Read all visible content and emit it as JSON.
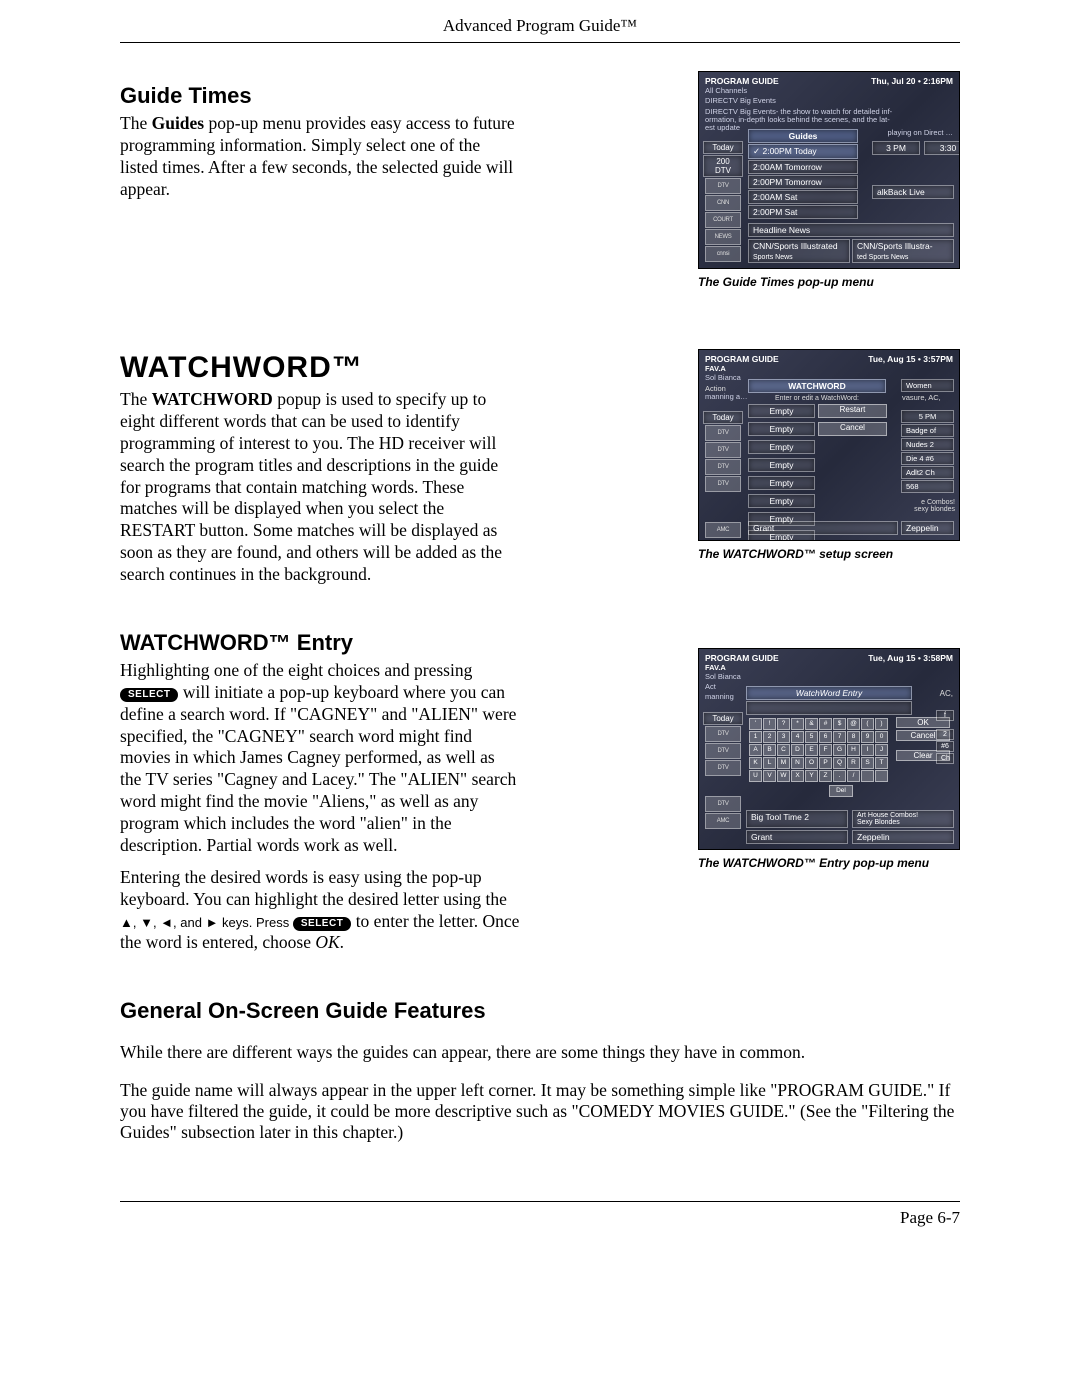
{
  "running_head": "Advanced Program Guide™",
  "footer": "Page 6-7",
  "guide_times": {
    "heading": "Guide Times",
    "body_html": "The <b>Guides</b> pop-up menu provides easy access to future programming information. Simply select one of the listed times. After a few seconds, the selected guide will appear.",
    "caption": "The Guide Times pop-up menu",
    "shot": {
      "title": "PROGRAM GUIDE",
      "subtitle": "All Channels",
      "datetime": "Thu, Jul 20 • 2:16PM",
      "banner_line2": "DIRECTV  Big Events",
      "banner_line3": "DIRECTV Big Events- the show to watch for detailed inf-\normation, in-depth looks behind the scenes, and the lat-\nest update",
      "popup_title": "Guides",
      "popup_right": "playing on Direct …",
      "options": [
        "✓ 2:00PM Today",
        "2:00AM Tomorrow",
        "2:00PM Tomorrow",
        "2:00AM Sat",
        "2:00PM Sat"
      ],
      "col_left": [
        "Today",
        "200\nDTV"
      ],
      "col_head_right": [
        "3 PM",
        "3:30"
      ],
      "right_cell": "alkBack Live",
      "bottom_rows": [
        "Headline News",
        "CNN/Sports Illustrated",
        "Sports News",
        "CNN/Sports Illustra-",
        "ted Sports News"
      ],
      "left_logos": [
        "DTV",
        "DTV",
        "CNN",
        "COURT",
        "NEWS",
        "cnnsi"
      ]
    }
  },
  "watchword": {
    "heading": "WATCHWORD™",
    "body_html": "The <b>WATCHWORD</b> popup is used to specify up to eight different words that can be used to identify programming of interest to you. The HD receiver will search the program titles and descriptions in the guide for programs that contain matching words. These matches will be displayed when you select the RESTART button. Some matches will be displayed as soon as they are found, and others will be added as the search continues in the background.",
    "caption": "The WATCHWORD™ setup screen",
    "shot": {
      "title": "PROGRAM GUIDE",
      "subtitle": "FAV.A",
      "datetime": "Tue, Aug 15 • 3:57PM",
      "row2_left": "Sol Bianca",
      "row3_left": "Action",
      "row4_left": "manning a…",
      "popup_title": "WATCHWORD",
      "popup_sub": "Enter or edit a WatchWord:",
      "buttons": [
        "Restart",
        "Cancel"
      ],
      "slots": [
        "Empty",
        "Empty",
        "Empty",
        "Empty",
        "Empty",
        "Empty",
        "Empty",
        "Empty"
      ],
      "right_col": [
        "Women",
        "vasure, AC,",
        "5 PM",
        "Badge of",
        "Nudes 2",
        "Die 4 #6",
        "Adlt2 Ch",
        "568",
        "e Combos!",
        "sexy blondes"
      ],
      "bottom_left": "Grant",
      "bottom_right": "Zeppelin",
      "left_col": [
        "Today"
      ],
      "left_logos": [
        "DTV",
        "DTV",
        "DTV",
        "DTV",
        "AMC"
      ]
    }
  },
  "entry": {
    "heading": "WATCHWORD™ Entry",
    "p1_prefix": "Highlighting one of the eight choices and pressing ",
    "select_label": "SELECT",
    "p1_suffix": " will initiate a pop-up keyboard where you can define a search word. If \"CAGNEY\" and \"ALIEN\" were specified, the \"CAGNEY\" search word might find movies in which James Cagney performed, as well as the TV series \"Cagney and Lacey.\" The \"ALIEN\" search word might find the movie \"Aliens,\" as well as any program which includes the word \"alien\" in the description. Partial words work as well.",
    "p2_prefix": "Entering the desired words is easy using the pop-up keyboard. You can highlight the desired letter using the ",
    "arrows": "▲, ▼, ◄, and ► keys. Press ",
    "p2_middle": " to enter the letter. Once the word is entered, choose ",
    "ok_label": "OK",
    "p2_suffix": ".",
    "caption": "The WATCHWORD™ Entry pop-up menu",
    "shot": {
      "title": "PROGRAM GUIDE",
      "subtitle": "FAV.A",
      "datetime": "Tue, Aug 15 • 3:58PM",
      "banner2": "Sol Bianca",
      "banner3": "Act",
      "banner4": "manning",
      "right_word": "AC,",
      "popup_title": "WatchWord Entry",
      "buttons": [
        "OK",
        "Cancel",
        "Clear"
      ],
      "del_key": "Del",
      "keys_row1": [
        "'",
        "!",
        "?",
        "*",
        "&",
        "#",
        "$",
        "@",
        "(",
        ")"
      ],
      "keys_row2": [
        "1",
        "2",
        "3",
        "4",
        "5",
        "6",
        "7",
        "8",
        "9",
        "0"
      ],
      "keys_row3": [
        "A",
        "B",
        "C",
        "D",
        "E",
        "F",
        "G",
        "H",
        "I",
        "J"
      ],
      "keys_row4": [
        "K",
        "L",
        "M",
        "N",
        "O",
        "P",
        "Q",
        "R",
        "S",
        "T"
      ],
      "keys_row5": [
        "U",
        "V",
        "W",
        "X",
        "Y",
        "Z",
        ".",
        "/",
        " ",
        " "
      ],
      "right_col": [
        "f",
        "2",
        "#6",
        "Ch"
      ],
      "bottom": [
        "Big Tool Time 2",
        "Art House Combos!",
        "Sexy Blondes",
        "Grant",
        "Zeppelin"
      ],
      "left_col": [
        "Today"
      ],
      "left_logos": [
        "DTV",
        "DTV",
        "DTV",
        "DTV",
        "AMC"
      ]
    }
  },
  "general": {
    "heading": "General On-Screen Guide Features",
    "p1": "While there are different ways the guides can appear, there are some things they have in common.",
    "p2": "The guide name will always appear in the upper left corner. It may be something simple like \"PROGRAM GUIDE.\" If you have filtered the guide, it could be more descriptive such as \"COMEDY MOVIES GUIDE.\" (See the \"Filtering the Guides\" subsection later in this chapter.)"
  }
}
